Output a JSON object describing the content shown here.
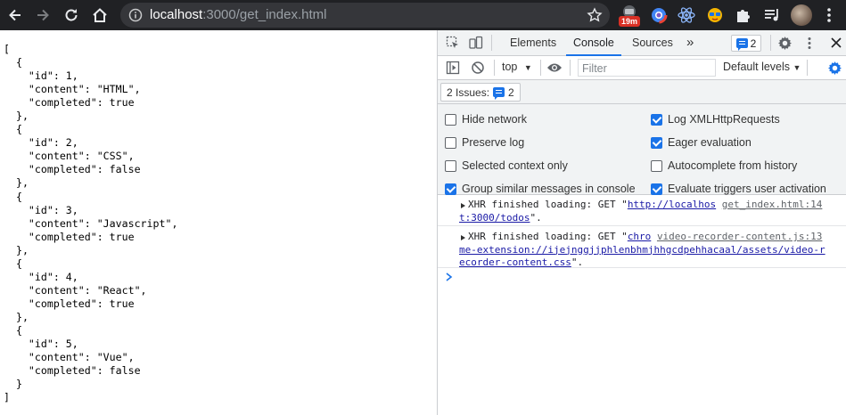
{
  "browser": {
    "url_host": "localhost",
    "url_path": ":3000/get_index.html",
    "extension_badge": "19m"
  },
  "page": {
    "json_text": "[\n  {\n    \"id\": 1,\n    \"content\": \"HTML\",\n    \"completed\": true\n  },\n  {\n    \"id\": 2,\n    \"content\": \"CSS\",\n    \"completed\": false\n  },\n  {\n    \"id\": 3,\n    \"content\": \"Javascript\",\n    \"completed\": true\n  },\n  {\n    \"id\": 4,\n    \"content\": \"React\",\n    \"completed\": true\n  },\n  {\n    \"id\": 5,\n    \"content\": \"Vue\",\n    \"completed\": false\n  }\n]"
  },
  "devtools": {
    "tabs": [
      "Elements",
      "Console",
      "Sources"
    ],
    "active_tab": "Console",
    "more_tabs": "»",
    "issue_count": "2",
    "context": "top",
    "filter_placeholder": "Filter",
    "levels": "Default levels",
    "issues_label": "2 Issues:",
    "issues_count": "2",
    "settings": {
      "hide_network": {
        "label": "Hide network",
        "checked": false
      },
      "preserve_log": {
        "label": "Preserve log",
        "checked": false
      },
      "selected_context": {
        "label": "Selected context only",
        "checked": false
      },
      "group_similar": {
        "label": "Group similar messages in console",
        "checked": true
      },
      "log_xhr": {
        "label": "Log XMLHttpRequests",
        "checked": true
      },
      "eager_eval": {
        "label": "Eager evaluation",
        "checked": true
      },
      "autocomplete": {
        "label": "Autocomplete from history",
        "checked": false
      },
      "eval_triggers": {
        "label": "Evaluate triggers user activation",
        "checked": true
      }
    },
    "messages": [
      {
        "prefix": "XHR finished loading: GET \"",
        "link": "http://localhos",
        "source": "get_index.html:14",
        "cont_link": "t:3000/todos",
        "suffix": "\"."
      },
      {
        "prefix": "XHR finished loading: GET \"",
        "link": "chro",
        "source": "video-recorder-content.js:13",
        "cont_link": "me-extension://ijejnggjjphlenbhmjhhgcdpehhacaal/assets/video-recorder-content.css",
        "suffix": "\"."
      }
    ]
  },
  "colors": {
    "toolbar_bg": "#202124",
    "accent": "#1a73e8",
    "link": "#1a1aa6"
  }
}
